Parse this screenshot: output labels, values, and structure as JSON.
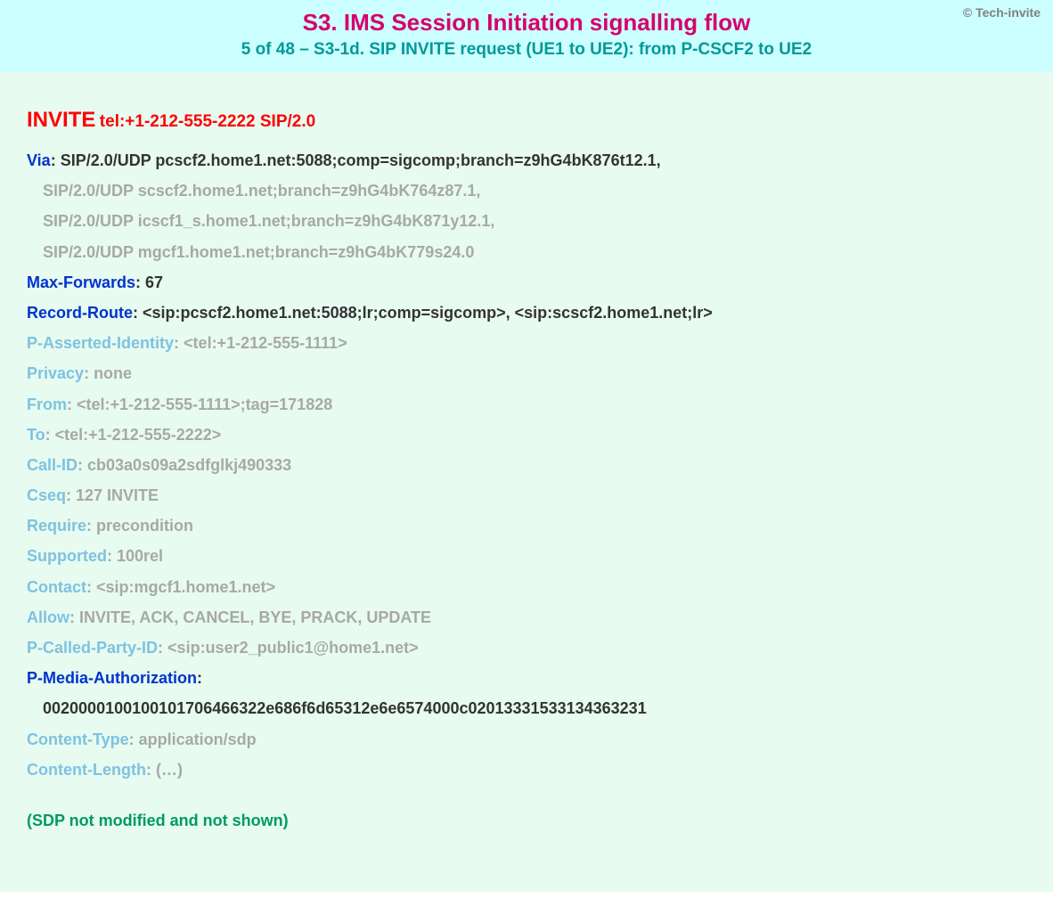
{
  "copyright": "© Tech-invite",
  "title": "S3. IMS Session Initiation signalling flow",
  "subtitle": "5 of 48 – S3-1d. SIP INVITE request (UE1 to UE2): from P-CSCF2 to UE2",
  "request": {
    "method": "INVITE",
    "uri": "tel:+1-212-555-2222 SIP/2.0"
  },
  "headers": [
    {
      "kind": "first",
      "name": "Via",
      "value": "SIP/2.0/UDP pcscf2.home1.net:5088;comp=sigcomp;branch=z9hG4bK876t12.1,",
      "strong": true
    },
    {
      "kind": "cont",
      "value": "SIP/2.0/UDP scscf2.home1.net;branch=z9hG4bK764z87.1,"
    },
    {
      "kind": "cont",
      "value": "SIP/2.0/UDP icscf1_s.home1.net;branch=z9hG4bK871y12.1,"
    },
    {
      "kind": "cont",
      "value": "SIP/2.0/UDP mgcf1.home1.net;branch=z9hG4bK779s24.0"
    },
    {
      "kind": "first",
      "name": "Max-Forwards",
      "value": "67",
      "strong": true
    },
    {
      "kind": "first",
      "name": "Record-Route",
      "value": "<sip:pcscf2.home1.net:5088;lr;comp=sigcomp>, <sip:scscf2.home1.net;lr>",
      "strong": true
    },
    {
      "kind": "first",
      "name": "P-Asserted-Identity",
      "value": "<tel:+1-212-555-1111>",
      "strong": false
    },
    {
      "kind": "first",
      "name": "Privacy",
      "value": "none",
      "strong": false
    },
    {
      "kind": "first",
      "name": "From",
      "value": "<tel:+1-212-555-1111>;tag=171828",
      "strong": false
    },
    {
      "kind": "first",
      "name": "To",
      "value": "<tel:+1-212-555-2222>",
      "strong": false
    },
    {
      "kind": "first",
      "name": "Call-ID",
      "value": "cb03a0s09a2sdfglkj490333",
      "strong": false
    },
    {
      "kind": "first",
      "name": "Cseq",
      "value": "127 INVITE",
      "strong": false
    },
    {
      "kind": "first",
      "name": "Require",
      "value": "precondition",
      "strong": false
    },
    {
      "kind": "first",
      "name": "Supported",
      "value": "100rel",
      "strong": false
    },
    {
      "kind": "first",
      "name": "Contact",
      "value": "<sip:mgcf1.home1.net>",
      "strong": false
    },
    {
      "kind": "first",
      "name": "Allow",
      "value": "INVITE, ACK, CANCEL, BYE, PRACK, UPDATE",
      "strong": false
    },
    {
      "kind": "first",
      "name": "P-Called-Party-ID",
      "value": "<sip:user2_public1@home1.net>",
      "strong": false
    },
    {
      "kind": "first",
      "name": "P-Media-Authorization",
      "value": "",
      "strong": true
    },
    {
      "kind": "cont-strong",
      "value": "0020000100100101706466322e686f6d65312e6e6574000c02013331533134363231"
    },
    {
      "kind": "first",
      "name": "Content-Type",
      "value": "application/sdp",
      "strong": false
    },
    {
      "kind": "first",
      "name": "Content-Length",
      "value": "(…)",
      "strong": false
    }
  ],
  "note": "(SDP not modified and not shown)"
}
